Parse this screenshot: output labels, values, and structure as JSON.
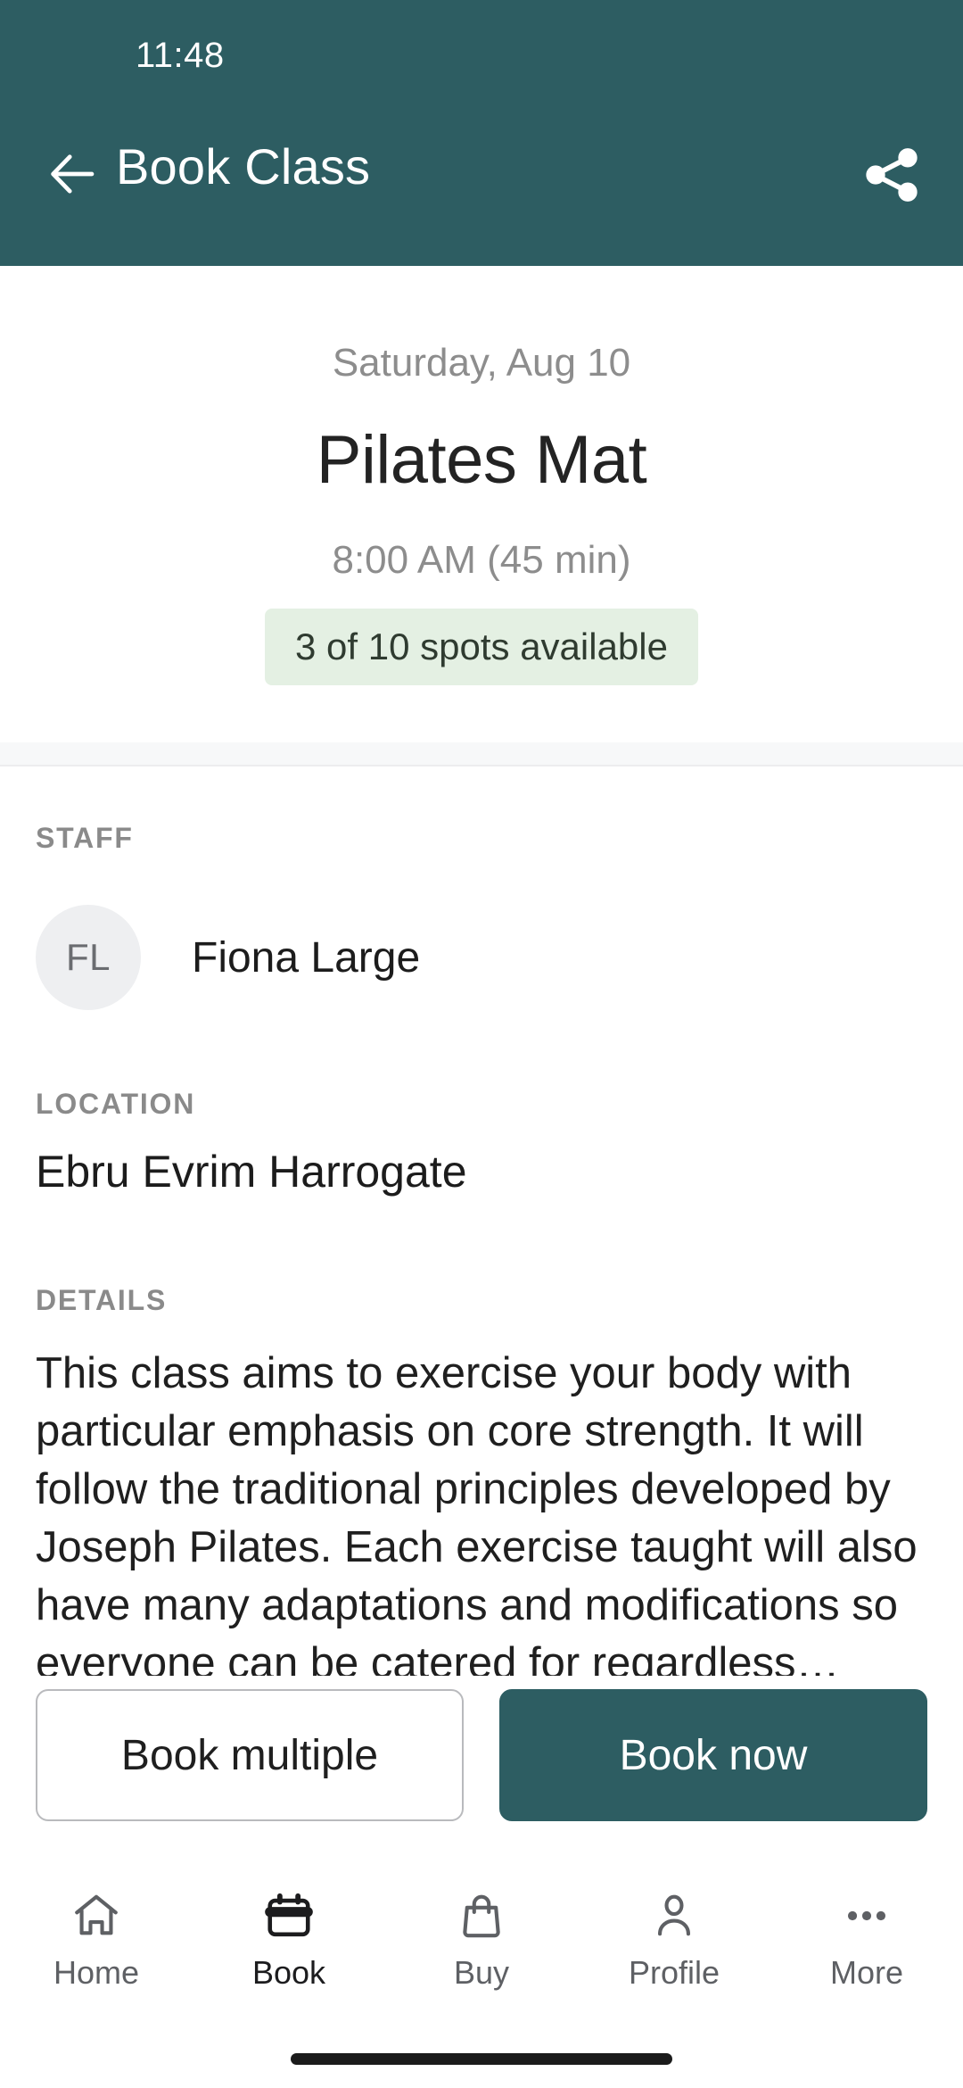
{
  "status_bar": {
    "time": "11:48"
  },
  "app_bar": {
    "title": "Book Class",
    "back_icon": "arrow-left-icon",
    "share_icon": "share-icon"
  },
  "hero": {
    "date": "Saturday, Aug 10",
    "class_name": "Pilates Mat",
    "time": "8:00 AM (45 min)",
    "availability": "3 of 10 spots available",
    "availability_bg": "#E4F0E3",
    "availability_text_color": "#2F3B30"
  },
  "sections": {
    "staff": {
      "label": "STAFF",
      "avatar_initials": "FL",
      "name": "Fiona Large"
    },
    "location": {
      "label": "LOCATION",
      "value": "Ebru Evrim Harrogate"
    },
    "details": {
      "label": "DETAILS",
      "text": "This class aims to exercise your body with particular emphasis on core strength. It will follow the traditional principles developed by Joseph Pilates. Each exercise taught will also have many adaptations and modifications so everyone can be catered for regardless…"
    }
  },
  "actions": {
    "secondary_label": "Book multiple",
    "primary_label": "Book now",
    "primary_bg": "#2D5D62"
  },
  "bottom_nav": {
    "items": [
      {
        "label": "Home",
        "icon": "home-icon",
        "active": false
      },
      {
        "label": "Book",
        "icon": "calendar-icon",
        "active": true
      },
      {
        "label": "Buy",
        "icon": "bag-icon",
        "active": false
      },
      {
        "label": "Profile",
        "icon": "person-icon",
        "active": false
      },
      {
        "label": "More",
        "icon": "ellipsis-icon",
        "active": false
      }
    ]
  },
  "theme": {
    "header_color": "#2D5D62",
    "accent_color": "#2D5D62"
  }
}
